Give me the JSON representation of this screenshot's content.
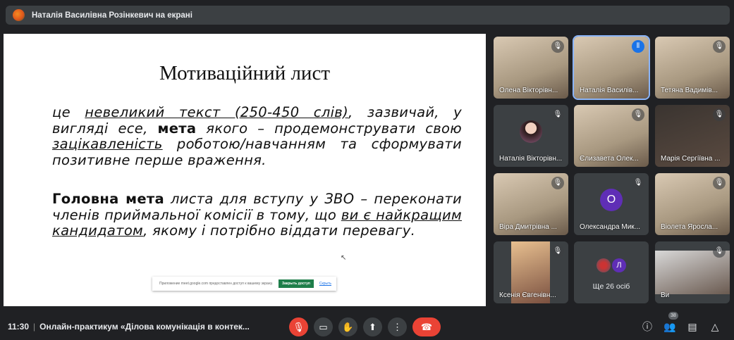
{
  "topbar": {
    "title": "Наталія Василівна Розінкевич на екрані"
  },
  "slide": {
    "title": "Мотиваційний лист",
    "p1": [
      "це ",
      "невеликий текст (250-450 слів)",
      ", зазвичай, у вигляді есе, ",
      "мета",
      " якого – продемонструвати свою ",
      "зацікавленість",
      " роботою/навчанням та сформувати позитивне перше враження."
    ],
    "p2": [
      "Головна мета",
      " листа для вступу у ЗВО – переконати членів приймальної комісії в тому, що ",
      "ви є найкращим кандидатом",
      ", якому і потрібно віддати перевагу."
    ]
  },
  "share_bar": {
    "text": "Приложение meet.google.com предоставлен доступ к вашему экрану.",
    "stop": "Закрыть доступ",
    "hide": "Скрыть"
  },
  "participants": [
    {
      "name": "Олена Вікторівн..."
    },
    {
      "name": "Наталія Василів..."
    },
    {
      "name": "Тетяна Вадимів..."
    },
    {
      "name": "Наталія Вікторівн..."
    },
    {
      "name": "Єлизавета Олек..."
    },
    {
      "name": "Марія Сергіївна ..."
    },
    {
      "name": "Віра Дмитрівна ..."
    },
    {
      "name": "Олександра Мик...",
      "initial": "О"
    },
    {
      "name": "Віолета Яросла..."
    },
    {
      "name": "Ксенія Євгенівн..."
    },
    {
      "more": "Ще 26 осіб",
      "initial": "Л"
    },
    {
      "name": "Ви"
    }
  ],
  "bottom": {
    "time": "11:30",
    "meeting": "Онлайн-практикум «Ділова комунікація в контек...",
    "people_count": "38"
  },
  "colors": {
    "accent": "#1a73e8",
    "danger": "#ea4335",
    "avatar": "#5f2eb6"
  }
}
